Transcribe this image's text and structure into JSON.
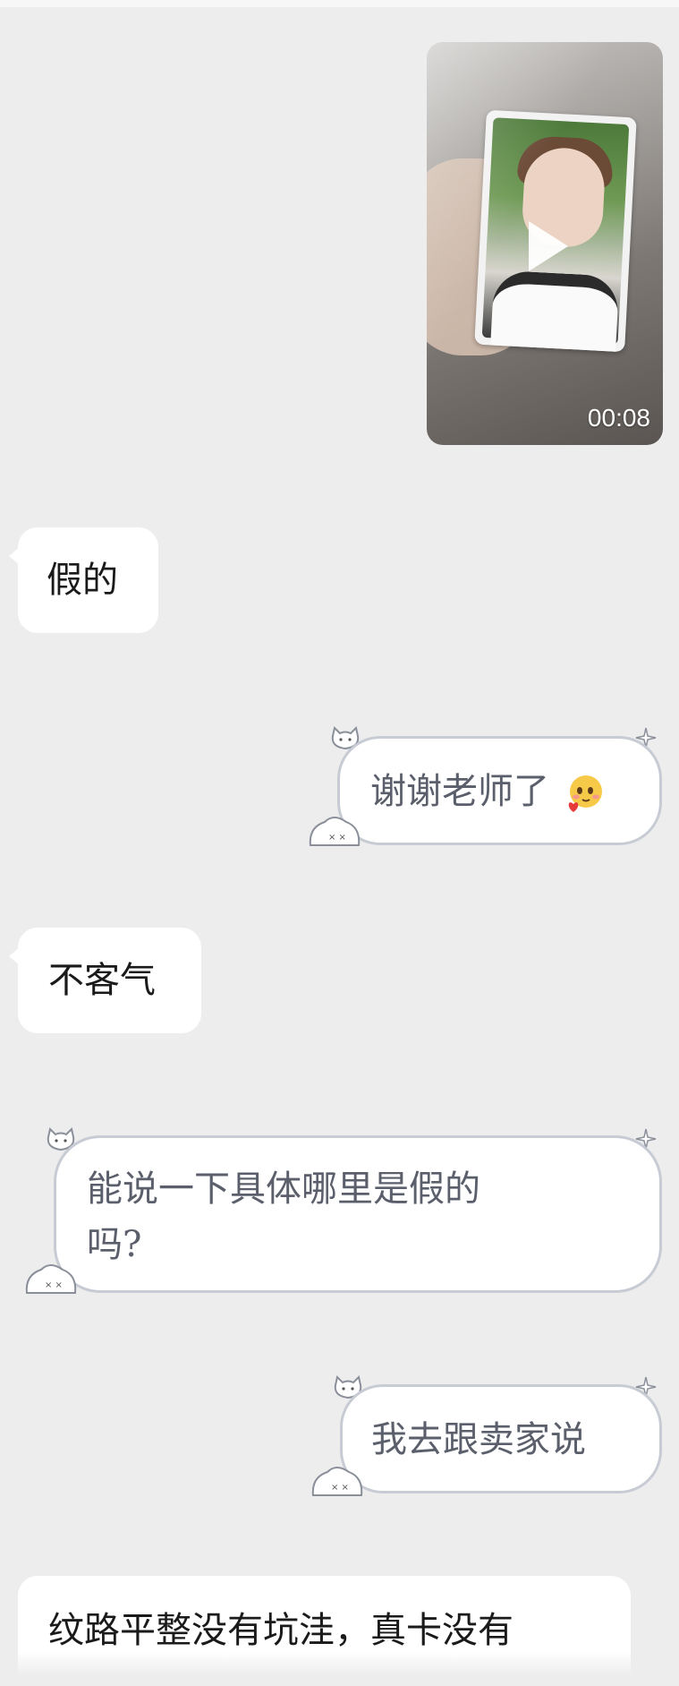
{
  "video": {
    "duration": "00:08",
    "play_icon": "play-icon"
  },
  "messages": [
    {
      "side": "received",
      "text": "假的"
    },
    {
      "side": "sent",
      "text": "谢谢老师了",
      "emoji": "blushing-heart-emoji"
    },
    {
      "side": "received",
      "text": "不客气"
    },
    {
      "side": "sent",
      "line1": "能说一下具体哪里是假的",
      "line2": "吗?"
    },
    {
      "side": "sent",
      "text": "我去跟卖家说"
    },
    {
      "side": "received",
      "text": "纹路平整没有坑洼，真卡没有"
    }
  ],
  "colors": {
    "background": "#ededed",
    "bubble": "#ffffff",
    "bubble_border": "#c7cbd4"
  }
}
